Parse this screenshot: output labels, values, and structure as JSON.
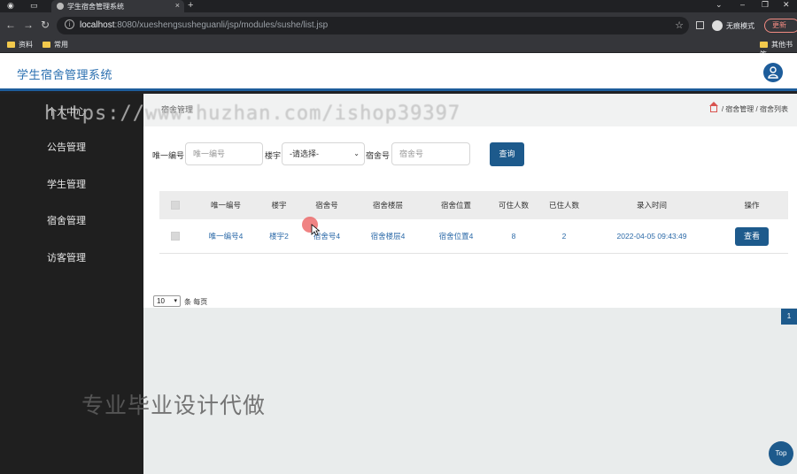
{
  "browser": {
    "tab_title": "学生宿舍管理系统",
    "tab_close": "×",
    "new_tab": "+",
    "url_host": "localhost",
    "url_rest": ":8080/xueshengsusheguanli/jsp/modules/sushe/list.jsp",
    "incognito_label": "无痕模式",
    "update_label": "更新",
    "bookmarks": [
      "资料",
      "常用"
    ],
    "bookmarks_other": "其他书签"
  },
  "app": {
    "title": "学生宿舍管理系统"
  },
  "sidebar": {
    "items": [
      {
        "label": "个人中心"
      },
      {
        "label": "公告管理"
      },
      {
        "label": "学生管理"
      },
      {
        "label": "宿舍管理"
      },
      {
        "label": "访客管理"
      }
    ]
  },
  "page": {
    "title": "宿舍管理",
    "breadcrumb": [
      "宿舍管理",
      "宿舍列表"
    ],
    "breadcrumb_sep": "/"
  },
  "search": {
    "label_id": "唯一编号",
    "placeholder_id": "唯一编号",
    "label_building": "楼宇",
    "building_selected": "-请选择-",
    "label_room": "宿舍号",
    "placeholder_room": "宿舍号",
    "query_button": "查询"
  },
  "table": {
    "headers": [
      "唯一编号",
      "楼宇",
      "宿舍号",
      "宿舍楼层",
      "宿舍位置",
      "可住人数",
      "已住人数",
      "录入时间",
      "操作"
    ],
    "rows": [
      {
        "id": "唯一编号4",
        "building": "楼宇2",
        "room": "宿舍号4",
        "floor": "宿舍楼层4",
        "location": "宿舍位置4",
        "capacity": "8",
        "occupied": "2",
        "created": "2022-04-05 09:43:49",
        "action": "查看"
      }
    ]
  },
  "pager": {
    "page_size": "10",
    "per_page_label": "条 每页",
    "current_page": "1"
  },
  "top_button": "Top",
  "watermarks": {
    "url": "https://www.huzhan.com/ishop39397",
    "text": "专业毕业设计代做"
  },
  "colors": {
    "primary": "#1d5a8c",
    "sidebar_bg": "#1f1f1f",
    "link": "#2c6aa8"
  }
}
